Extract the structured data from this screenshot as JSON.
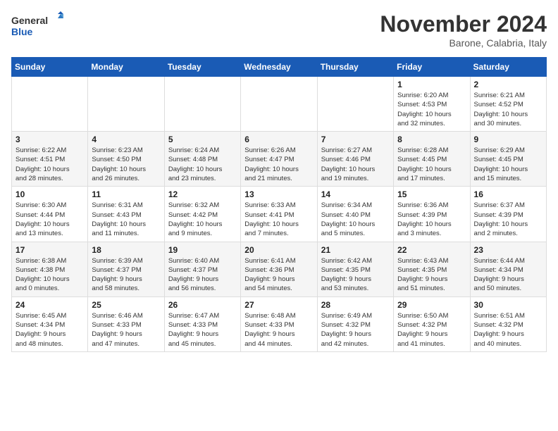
{
  "logo": {
    "line1": "General",
    "line2": "Blue"
  },
  "title": "November 2024",
  "location": "Barone, Calabria, Italy",
  "weekdays": [
    "Sunday",
    "Monday",
    "Tuesday",
    "Wednesday",
    "Thursday",
    "Friday",
    "Saturday"
  ],
  "weeks": [
    [
      {
        "day": "",
        "info": ""
      },
      {
        "day": "",
        "info": ""
      },
      {
        "day": "",
        "info": ""
      },
      {
        "day": "",
        "info": ""
      },
      {
        "day": "",
        "info": ""
      },
      {
        "day": "1",
        "info": "Sunrise: 6:20 AM\nSunset: 4:53 PM\nDaylight: 10 hours\nand 32 minutes."
      },
      {
        "day": "2",
        "info": "Sunrise: 6:21 AM\nSunset: 4:52 PM\nDaylight: 10 hours\nand 30 minutes."
      }
    ],
    [
      {
        "day": "3",
        "info": "Sunrise: 6:22 AM\nSunset: 4:51 PM\nDaylight: 10 hours\nand 28 minutes."
      },
      {
        "day": "4",
        "info": "Sunrise: 6:23 AM\nSunset: 4:50 PM\nDaylight: 10 hours\nand 26 minutes."
      },
      {
        "day": "5",
        "info": "Sunrise: 6:24 AM\nSunset: 4:48 PM\nDaylight: 10 hours\nand 23 minutes."
      },
      {
        "day": "6",
        "info": "Sunrise: 6:26 AM\nSunset: 4:47 PM\nDaylight: 10 hours\nand 21 minutes."
      },
      {
        "day": "7",
        "info": "Sunrise: 6:27 AM\nSunset: 4:46 PM\nDaylight: 10 hours\nand 19 minutes."
      },
      {
        "day": "8",
        "info": "Sunrise: 6:28 AM\nSunset: 4:45 PM\nDaylight: 10 hours\nand 17 minutes."
      },
      {
        "day": "9",
        "info": "Sunrise: 6:29 AM\nSunset: 4:45 PM\nDaylight: 10 hours\nand 15 minutes."
      }
    ],
    [
      {
        "day": "10",
        "info": "Sunrise: 6:30 AM\nSunset: 4:44 PM\nDaylight: 10 hours\nand 13 minutes."
      },
      {
        "day": "11",
        "info": "Sunrise: 6:31 AM\nSunset: 4:43 PM\nDaylight: 10 hours\nand 11 minutes."
      },
      {
        "day": "12",
        "info": "Sunrise: 6:32 AM\nSunset: 4:42 PM\nDaylight: 10 hours\nand 9 minutes."
      },
      {
        "day": "13",
        "info": "Sunrise: 6:33 AM\nSunset: 4:41 PM\nDaylight: 10 hours\nand 7 minutes."
      },
      {
        "day": "14",
        "info": "Sunrise: 6:34 AM\nSunset: 4:40 PM\nDaylight: 10 hours\nand 5 minutes."
      },
      {
        "day": "15",
        "info": "Sunrise: 6:36 AM\nSunset: 4:39 PM\nDaylight: 10 hours\nand 3 minutes."
      },
      {
        "day": "16",
        "info": "Sunrise: 6:37 AM\nSunset: 4:39 PM\nDaylight: 10 hours\nand 2 minutes."
      }
    ],
    [
      {
        "day": "17",
        "info": "Sunrise: 6:38 AM\nSunset: 4:38 PM\nDaylight: 10 hours\nand 0 minutes."
      },
      {
        "day": "18",
        "info": "Sunrise: 6:39 AM\nSunset: 4:37 PM\nDaylight: 9 hours\nand 58 minutes."
      },
      {
        "day": "19",
        "info": "Sunrise: 6:40 AM\nSunset: 4:37 PM\nDaylight: 9 hours\nand 56 minutes."
      },
      {
        "day": "20",
        "info": "Sunrise: 6:41 AM\nSunset: 4:36 PM\nDaylight: 9 hours\nand 54 minutes."
      },
      {
        "day": "21",
        "info": "Sunrise: 6:42 AM\nSunset: 4:35 PM\nDaylight: 9 hours\nand 53 minutes."
      },
      {
        "day": "22",
        "info": "Sunrise: 6:43 AM\nSunset: 4:35 PM\nDaylight: 9 hours\nand 51 minutes."
      },
      {
        "day": "23",
        "info": "Sunrise: 6:44 AM\nSunset: 4:34 PM\nDaylight: 9 hours\nand 50 minutes."
      }
    ],
    [
      {
        "day": "24",
        "info": "Sunrise: 6:45 AM\nSunset: 4:34 PM\nDaylight: 9 hours\nand 48 minutes."
      },
      {
        "day": "25",
        "info": "Sunrise: 6:46 AM\nSunset: 4:33 PM\nDaylight: 9 hours\nand 47 minutes."
      },
      {
        "day": "26",
        "info": "Sunrise: 6:47 AM\nSunset: 4:33 PM\nDaylight: 9 hours\nand 45 minutes."
      },
      {
        "day": "27",
        "info": "Sunrise: 6:48 AM\nSunset: 4:33 PM\nDaylight: 9 hours\nand 44 minutes."
      },
      {
        "day": "28",
        "info": "Sunrise: 6:49 AM\nSunset: 4:32 PM\nDaylight: 9 hours\nand 42 minutes."
      },
      {
        "day": "29",
        "info": "Sunrise: 6:50 AM\nSunset: 4:32 PM\nDaylight: 9 hours\nand 41 minutes."
      },
      {
        "day": "30",
        "info": "Sunrise: 6:51 AM\nSunset: 4:32 PM\nDaylight: 9 hours\nand 40 minutes."
      }
    ]
  ]
}
